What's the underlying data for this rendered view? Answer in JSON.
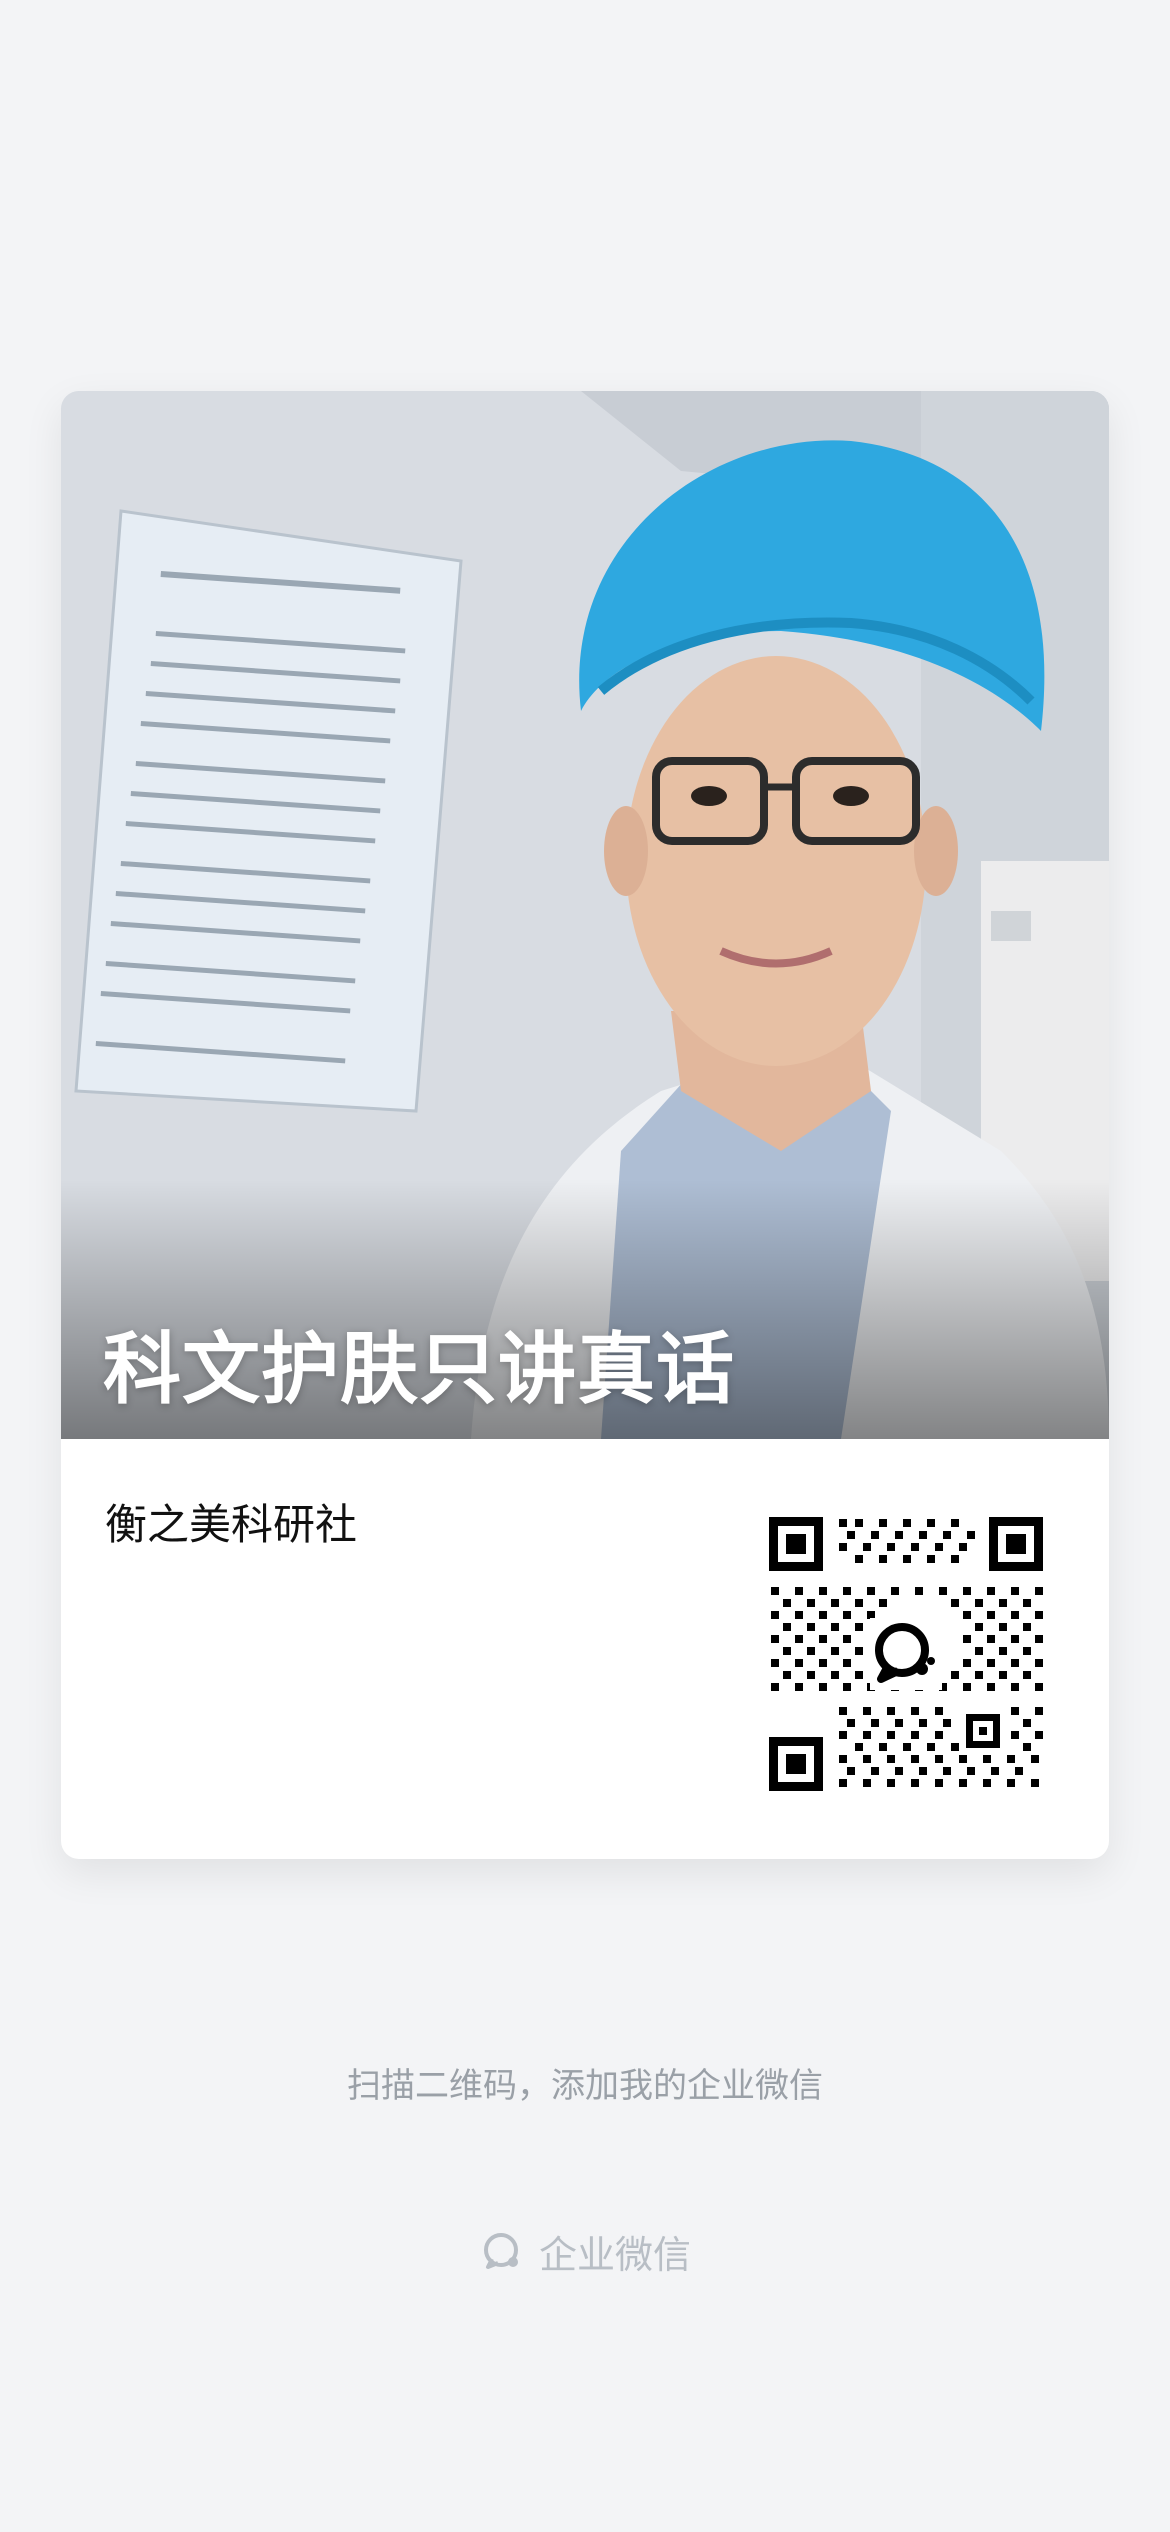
{
  "card": {
    "slogan": "科文护肤只讲真话",
    "company_name": "衡之美科研社"
  },
  "qr": {
    "icon": "wechat-work-logo-icon"
  },
  "footer": {
    "instruction": "扫描二维码，添加我的企业微信",
    "brand": "企业微信",
    "brand_icon": "wechat-work-logo-icon"
  }
}
